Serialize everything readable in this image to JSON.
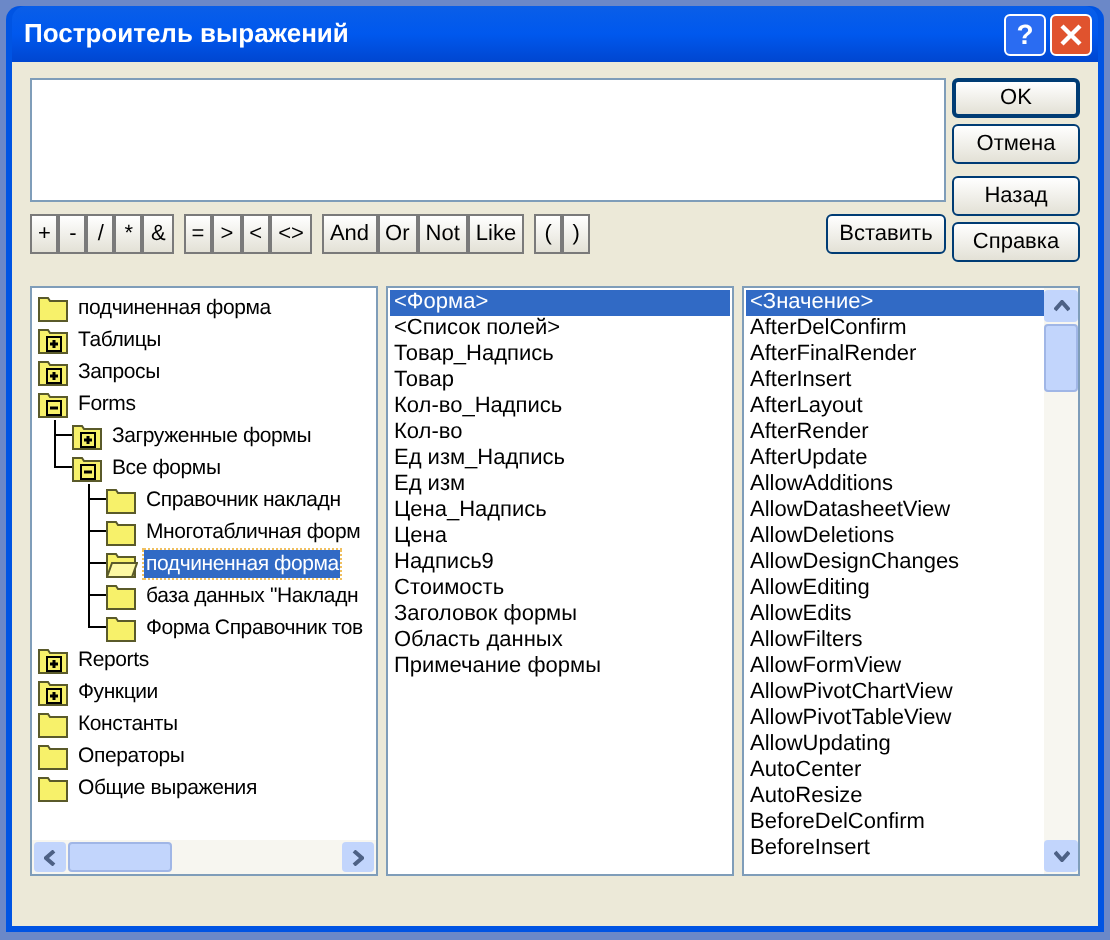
{
  "window": {
    "title": "Построитель выражений",
    "help": "?"
  },
  "side_buttons": [
    {
      "label": "OK",
      "default": true
    },
    {
      "label": "Отмена",
      "default": false
    },
    {
      "label": "Назад",
      "default": false
    },
    {
      "label": "Справка",
      "default": false
    }
  ],
  "operator_groups": [
    [
      "+",
      "-",
      "/",
      "*",
      "&"
    ],
    [
      "=",
      ">",
      "<",
      "<>"
    ],
    [
      "And",
      "Or",
      "Not",
      "Like"
    ],
    [
      "(",
      ")"
    ]
  ],
  "insert_button": "Вставить",
  "tree": [
    {
      "label": "подчиненная форма",
      "kind": "folder",
      "selected": false
    },
    {
      "label": "Таблицы",
      "kind": "plus",
      "selected": false
    },
    {
      "label": "Запросы",
      "kind": "plus",
      "selected": false
    },
    {
      "label": "Forms",
      "kind": "minus",
      "selected": false,
      "children": [
        {
          "label": "Загруженные формы",
          "kind": "plus",
          "selected": false
        },
        {
          "label": "Все формы",
          "kind": "minus",
          "selected": false,
          "children": [
            {
              "label": "Справочник накладн",
              "kind": "folder",
              "selected": false
            },
            {
              "label": "Многотабличная форм",
              "kind": "folder",
              "selected": false
            },
            {
              "label": "подчиненная форма",
              "kind": "open",
              "selected": true
            },
            {
              "label": "база данных \"Накладн",
              "kind": "folder",
              "selected": false
            },
            {
              "label": "Форма Справочник тов",
              "kind": "folder",
              "selected": false
            }
          ]
        }
      ]
    },
    {
      "label": "Reports",
      "kind": "plus",
      "selected": false
    },
    {
      "label": "Функции",
      "kind": "plus",
      "selected": false
    },
    {
      "label": "Константы",
      "kind": "folder",
      "selected": false
    },
    {
      "label": "Операторы",
      "kind": "folder",
      "selected": false
    },
    {
      "label": "Общие выражения",
      "kind": "folder",
      "selected": false
    }
  ],
  "fields": [
    {
      "label": "<Форма>",
      "selected": true
    },
    {
      "label": "<Список полей>",
      "selected": false
    },
    {
      "label": "Товар_Надпись",
      "selected": false
    },
    {
      "label": "Товар",
      "selected": false
    },
    {
      "label": "Кол-во_Надпись",
      "selected": false
    },
    {
      "label": "Кол-во",
      "selected": false
    },
    {
      "label": "Ед изм_Надпись",
      "selected": false
    },
    {
      "label": "Ед изм",
      "selected": false
    },
    {
      "label": "Цена_Надпись",
      "selected": false
    },
    {
      "label": "Цена",
      "selected": false
    },
    {
      "label": "Надпись9",
      "selected": false
    },
    {
      "label": "Стоимость",
      "selected": false
    },
    {
      "label": "Заголовок формы",
      "selected": false
    },
    {
      "label": "Область данных",
      "selected": false
    },
    {
      "label": "Примечание формы",
      "selected": false
    }
  ],
  "values": [
    {
      "label": "<Значение>",
      "selected": true
    },
    {
      "label": "AfterDelConfirm",
      "selected": false
    },
    {
      "label": "AfterFinalRender",
      "selected": false
    },
    {
      "label": "AfterInsert",
      "selected": false
    },
    {
      "label": "AfterLayout",
      "selected": false
    },
    {
      "label": "AfterRender",
      "selected": false
    },
    {
      "label": "AfterUpdate",
      "selected": false
    },
    {
      "label": "AllowAdditions",
      "selected": false
    },
    {
      "label": "AllowDatasheetView",
      "selected": false
    },
    {
      "label": "AllowDeletions",
      "selected": false
    },
    {
      "label": "AllowDesignChanges",
      "selected": false
    },
    {
      "label": "AllowEditing",
      "selected": false
    },
    {
      "label": "AllowEdits",
      "selected": false
    },
    {
      "label": "AllowFilters",
      "selected": false
    },
    {
      "label": "AllowFormView",
      "selected": false
    },
    {
      "label": "AllowPivotChartView",
      "selected": false
    },
    {
      "label": "AllowPivotTableView",
      "selected": false
    },
    {
      "label": "AllowUpdating",
      "selected": false
    },
    {
      "label": "AutoCenter",
      "selected": false
    },
    {
      "label": "AutoResize",
      "selected": false
    },
    {
      "label": "BeforeDelConfirm",
      "selected": false
    },
    {
      "label": "BeforeInsert",
      "selected": false
    }
  ]
}
